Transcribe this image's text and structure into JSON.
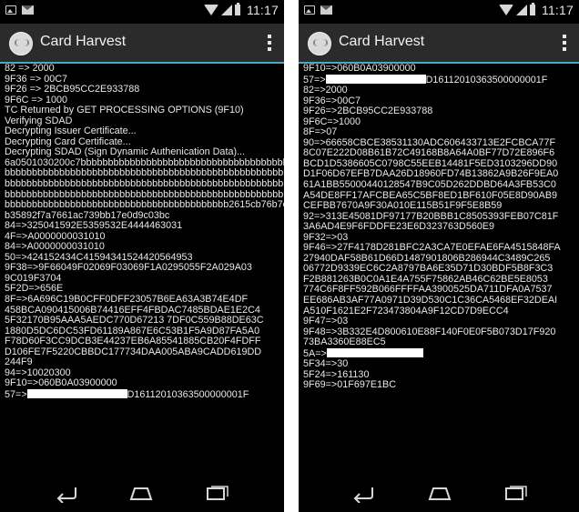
{
  "status_bar": {
    "time": "11:17"
  },
  "app": {
    "title": "Card Harvest"
  },
  "left_screen": {
    "log_lines": [
      "82 => 2000",
      "9F36 => 00C7",
      "9F26 => 2BCB95CC2E933788",
      "9F6C => 1000",
      "TC Returned by GET PROCESSING OPTIONS (9F10)",
      "Verifying SDAD",
      "Decrypting Issuer Certificate...",
      "Decrypting Card Certificate...",
      "Decrypting SDAD (Sign Dynamic Authenication Data)...",
      "6a0501030200c7bbbbbbbbbbbbbbbbbbbbbbbbbbbbbbbbbbbbbbb",
      "bbbbbbbbbbbbbbbbbbbbbbbbbbbbbbbbbbbbbbbbbbbbbbbbbbbbb",
      "bbbbbbbbbbbbbbbbbbbbbbbbbbbbbbbbbbbbbbbbbbbbbbbbbbbbb",
      "bbbbbbbbbbbbbbbbbbbbbbbbbbbbbbbbbbbbbbbbbbbbbbbbbbbbb",
      "bbbbbbbbbbbbbbbbbbbbbbbbbbbbbbbbbbbbbbbbb2615cb76b7e",
      "b35892f7a7661ac739bb17e0d9c03bc",
      "84=>325041592E5359532E4444463031",
      "4F=>A0000000031010",
      "84=>A0000000031010",
      "50=>424152434C41594341524420564953",
      "9F38=>9F66049F02069F03069F1A0295055F2A029A03",
      "9C019F3704",
      "5F2D=>656E",
      "8F=>6A696C19B0CFF0DFF23057B6EA63A3B74E4DF",
      "458BCA090415006B74416EFF4FBDAC7485BDAE1E2C4",
      "5F32170B95AAA5AEDC770D67213 7DF0C559B88DE63C",
      "1880D5DC6DC53FD61189A867E6C53B1F5A9D87FA5A0",
      "F78D60F3CC9DCB3E44237EB6A85541885CB20F4FDFF",
      "D106FE7F5220CBBDC177734DAA005ABA9CADD619DD",
      "244F9",
      "94=>10020300",
      "9F10=>060B0A03900000"
    ],
    "redacted_line": {
      "prefix": "57=>",
      "suffix": "D16112010363500000001F"
    }
  },
  "right_screen": {
    "first_line": "9F10=>060B0A03900000",
    "redacted_line_1": {
      "prefix": "57=>",
      "suffix": "D16112010363500000001F"
    },
    "log_lines": [
      "82=>2000",
      "9F36=>00C7",
      "9F26=>2BCB95CC2E933788",
      "9F6C=>1000",
      "8F=>07",
      "90=>66658CBCE38531130ADC606433713E2FCBCA77F",
      "8C07E222D08B61B72C49168B8A64A0BF77D72E896F6",
      "BCD1D5386605C0798C55EEB14481F5ED3103296DD90",
      "D1F06D67EFB7DAA26D18960FD74B13862A9B26F9EA0",
      "61A1BB55000440128547B9C05D262DDBD64A3FB53C0",
      "A54DE8FF17AFCBEA65C5BF8ED1BF610F05E8D90AB9",
      "CEFBB7670A9F30A010E115B51F9F5E8B59",
      "92=>313E45081DF97177B20BBB1C8505393FEB07C81F",
      "3A6AD4E9F6FDDFE23E6D323763D560E9",
      "9F32=>03",
      "9F46=>27F4178D281BFC2A3CA7E0EFAE6FA4515848FA",
      "27940DAF58B61D66D1487901806B286944C3489C265",
      "06772D9339EC6C2A8797BA6E35D71D30BDF5B8F3C3",
      "F2B881263B0C0A1E4A755F75862AB46C62BE5E8053",
      "774C6F8FF592B066FFFFAA3900525DA711DFA0A7537",
      "EE686AB3AF77A0971D39D530C1C36CA5468EF32DEAI",
      "A510F1621E2F723473804A9F12CD7D9ECC4",
      "9F47=>03",
      "9F48=>3B332E4D800610E88F140F0E0F5B073D17F920",
      "73BA3360E88EC5"
    ],
    "redacted_line_2": {
      "prefix": "5A=>"
    },
    "tail_lines": [
      "5F34=>30",
      "5F24=>161130",
      "9F69=>01F697E1BC"
    ]
  }
}
